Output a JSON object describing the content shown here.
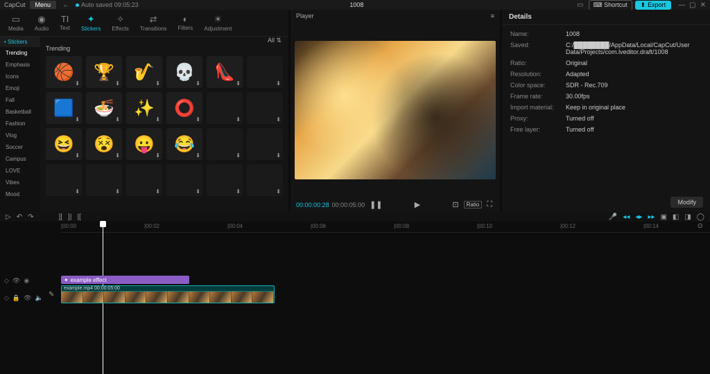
{
  "app_name": "CapCut",
  "menu_label": "Menu",
  "auto_saved": "Auto saved  09:05:23",
  "project_title": "1008",
  "shortcut_label": "Shortcut",
  "export_label": "Export",
  "tool_tabs": [
    {
      "label": "Media",
      "icon": "▭"
    },
    {
      "label": "Audio",
      "icon": "◉"
    },
    {
      "label": "Text",
      "icon": "TI"
    },
    {
      "label": "Stickers",
      "icon": "✦"
    },
    {
      "label": "Effects",
      "icon": "✧"
    },
    {
      "label": "Transitions",
      "icon": "⇄"
    },
    {
      "label": "Filters",
      "icon": "◐"
    },
    {
      "label": "Adjustment",
      "icon": "☀"
    }
  ],
  "active_tool": "Stickers",
  "sidebar": {
    "header": "• Stickers",
    "items": [
      "Trending",
      "Emphasis",
      "Icons",
      "Emoji",
      "Fall",
      "Basketball",
      "Fashion",
      "Vlog",
      "Soccer",
      "Campus",
      "LOVE",
      "Vibes",
      "Mood"
    ]
  },
  "all_label": "All  ⇅",
  "section_heading": "Trending",
  "sticker_icons": [
    "🏀",
    "🏆",
    "🎷",
    "💀",
    "👠",
    "",
    "🟦",
    "🍜",
    "✨",
    "⭕",
    "",
    "",
    "😆",
    "😵",
    "😛",
    "😂",
    "",
    "",
    "",
    "",
    "",
    "",
    "",
    ""
  ],
  "sticker_labels": [
    "basketball",
    "winner-trophy",
    "saxophone",
    "skull",
    "pink-heels",
    "",
    "labour-day",
    "bowl",
    "arrows",
    "red-circle",
    "",
    "",
    "emoji-laugh",
    "emoji-dizzy",
    "emoji-tongue",
    "emoji-haha",
    "",
    "",
    "",
    "",
    "",
    "",
    "",
    ""
  ],
  "player": {
    "title": "Player",
    "time_current": "00:00:00:28",
    "time_duration": "00:00:05:00",
    "ratio_label": "Ratio"
  },
  "details": {
    "title": "Details",
    "rows": [
      {
        "k": "Name:",
        "v": "1008"
      },
      {
        "k": "Saved:",
        "v": "C:/████████/AppData/Local/CapCut/User Data/Projects/com.lveditor.draft/1008"
      },
      {
        "k": "Ratio:",
        "v": "Original"
      },
      {
        "k": "Resolution:",
        "v": "Adapted"
      },
      {
        "k": "Color space:",
        "v": "SDR - Rec.709"
      },
      {
        "k": "Frame rate:",
        "v": "30.00fps"
      },
      {
        "k": "Import material:",
        "v": "Keep in original place"
      },
      {
        "k": "Proxy:",
        "v": "Turned off"
      },
      {
        "k": "Free layer:",
        "v": "Turned off"
      }
    ],
    "modify": "Modify"
  },
  "ruler_ticks": [
    "|00:00",
    "|00:02",
    "|00:04",
    "|00:06",
    "|00:08",
    "|00:10",
    "|00:12",
    "|00:14"
  ],
  "effect_label": "example effect",
  "video_clip_label": "example.mp4   00:00:05:00"
}
